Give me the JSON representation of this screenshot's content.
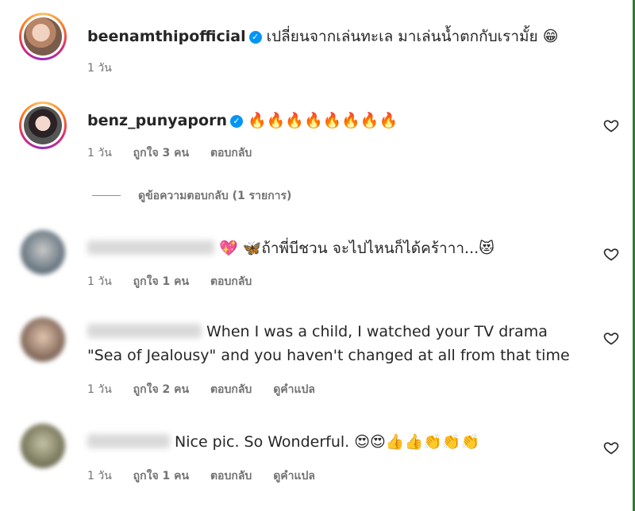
{
  "comments": [
    {
      "username": "beenamthipofficial",
      "text": "เปลี่ยนจากเล่นทะเล มาเล่นน้ำตกกับเรามั้ย 😁",
      "time": "1 วัน"
    },
    {
      "username": "benz_punyaporn",
      "text": "🔥🔥🔥🔥🔥🔥🔥🔥",
      "time": "1 วัน",
      "likes": "ถูกใจ 3 คน",
      "reply": "ตอบกลับ",
      "view_replies": "ดูข้อความตอบกลับ (1 รายการ)"
    },
    {
      "text": "💖 🦋ถ้าพี่บีชวน จะไปไหนก็ได้คร้าาา...😻",
      "time": "1 วัน",
      "likes": "ถูกใจ 1 คน",
      "reply": "ตอบกลับ"
    },
    {
      "text_line1": "When I was a child, I watched your TV drama",
      "text_line2": "\"Sea of Jealousy\" and you haven't changed at all from that time",
      "time": "1 วัน",
      "likes": "ถูกใจ 2 คน",
      "reply": "ตอบกลับ",
      "translate": "ดูคำแปล"
    },
    {
      "text": "Nice pic. So Wonderful. 😍😍👍👍👏👏👏",
      "time": "1 วัน",
      "likes": "ถูกใจ 1 คน",
      "reply": "ตอบกลับ",
      "translate": "ดูคำแปล"
    }
  ],
  "icons": {
    "like": "heart-icon",
    "verified": "verified-badge-icon"
  },
  "colors": {
    "verified": "#0095f6",
    "meta_text": "#737373",
    "text": "#262626"
  }
}
